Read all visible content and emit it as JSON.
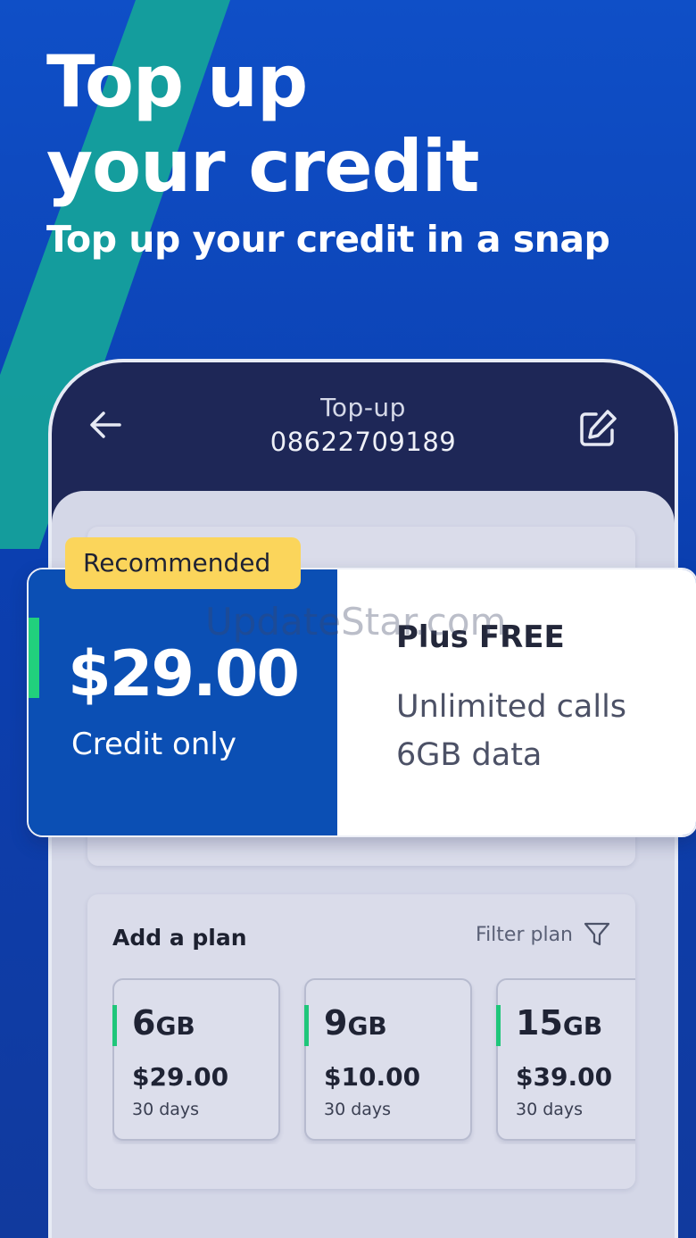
{
  "hero": {
    "title_line1": "Top up",
    "title_line2": "your credit",
    "subtitle": "Top up your credit in a snap"
  },
  "header": {
    "title": "Top-up",
    "number": "08622709189",
    "back_icon": "arrow-left-icon",
    "edit_icon": "edit-icon"
  },
  "recommended": {
    "badge": "Recommended",
    "price": "$29.00",
    "price_caption": "Credit only",
    "extras_title": "Plus FREE",
    "extras": [
      "Unlimited calls",
      "6GB data"
    ]
  },
  "add_plan": {
    "heading": "Add a plan",
    "filter_label": "Filter plan",
    "filter_icon": "filter-funnel-icon",
    "plans": [
      {
        "size": "6",
        "unit": "GB",
        "price": "$29.00",
        "duration": "30 days"
      },
      {
        "size": "9",
        "unit": "GB",
        "price": "$10.00",
        "duration": "30 days"
      },
      {
        "size": "15",
        "unit": "GB",
        "price": "$39.00",
        "duration": "30 days"
      }
    ]
  },
  "watermark": "UpdateStar.com",
  "colors": {
    "background": "#0f4fc7",
    "stripe": "#14a39a",
    "header": "#1e2757",
    "card_blue": "#0b4fb4",
    "accent_green": "#21d07d",
    "badge_yellow": "#fbd55b"
  }
}
